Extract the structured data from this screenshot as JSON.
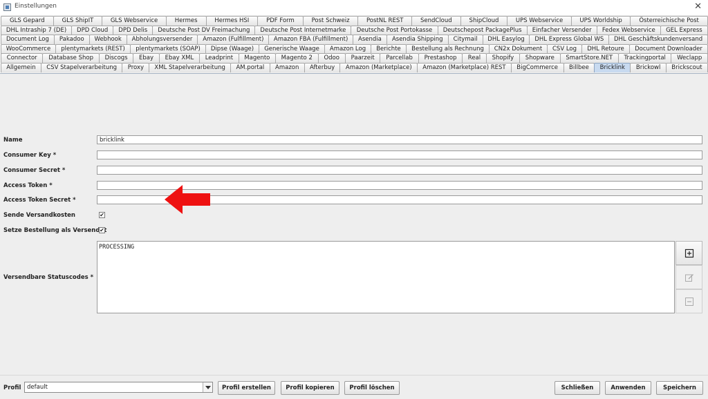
{
  "window": {
    "title": "Einstellungen",
    "close": "✕"
  },
  "tabs": {
    "rows": [
      [
        "GLS Gepard",
        "GLS ShipIT",
        "GLS Webservice",
        "Hermes",
        "Hermes HSI",
        "PDF Form",
        "Post Schweiz",
        "PostNL REST",
        "SendCloud",
        "ShipCloud",
        "UPS Webservice",
        "UPS Worldship",
        "Österreichische Post"
      ],
      [
        "DHL Intraship 7 (DE)",
        "DPD Cloud",
        "DPD Delis",
        "Deutsche Post DV Freimachung",
        "Deutsche Post Internetmarke",
        "Deutsche Post Portokasse",
        "Deutschepost PackagePlus",
        "Einfacher Versender",
        "Fedex Webservice",
        "GEL Express"
      ],
      [
        "Document Log",
        "Pakadoo",
        "Webhook",
        "Abholungsversender",
        "Amazon (Fulfillment)",
        "Amazon FBA (Fulfillment)",
        "Asendia",
        "Asendia Shipping",
        "Citymail",
        "DHL Easylog",
        "DHL Express Global WS",
        "DHL Geschäftskundenversand"
      ],
      [
        "WooCommerce",
        "plentymarkets (REST)",
        "plentymarkets (SOAP)",
        "Dipse (Waage)",
        "Generische Waage",
        "Amazon Log",
        "Berichte",
        "Bestellung als Rechnung",
        "CN2x Dokument",
        "CSV Log",
        "DHL Retoure",
        "Document Downloader"
      ],
      [
        "Connector",
        "Database Shop",
        "Discogs",
        "Ebay",
        "Ebay XML",
        "Leadprint",
        "Magento",
        "Magento 2",
        "Odoo",
        "Paarzeit",
        "Parcellab",
        "Prestashop",
        "Real",
        "Shopify",
        "Shopware",
        "SmartStore.NET",
        "Trackingportal",
        "Weclapp"
      ],
      [
        "Allgemein",
        "CSV Stapelverarbeitung",
        "Proxy",
        "XML Stapelverarbeitung",
        "AM.portal",
        "Amazon",
        "Afterbuy",
        "Amazon (Marketplace)",
        "Amazon (Marketplace) REST",
        "BigCommerce",
        "Billbee",
        "Bricklink",
        "Brickowl",
        "Brickscout"
      ]
    ],
    "active": "Bricklink"
  },
  "form": {
    "name_label": "Name",
    "name_value": "bricklink",
    "consumer_key_label": "Consumer Key *",
    "consumer_key_value": "",
    "consumer_secret_label": "Consumer Secret *",
    "consumer_secret_value": "",
    "access_token_label": "Access Token *",
    "access_token_value": "",
    "access_token_secret_label": "Access Token Secret *",
    "access_token_secret_value": "",
    "send_shipping_label": "Sende Versandkosten",
    "send_shipping_checked": true,
    "set_order_shipped_label": "Setze Bestellung als Versendet",
    "set_order_shipped_checked": true,
    "status_codes_label": "Versendbare Statuscodes *",
    "status_codes": [
      "PROCESSING"
    ],
    "check_mark": "✔"
  },
  "annotation": {
    "arrow_color": "#ee1111"
  },
  "icons": {
    "add": "plus-box-icon",
    "edit": "edit-icon",
    "remove": "minus-box-icon"
  },
  "footer": {
    "profil_label": "Profil",
    "profil_value": "default",
    "create_profile": "Profil erstellen",
    "copy_profile": "Profil kopieren",
    "delete_profile": "Profil löschen",
    "close": "Schließen",
    "apply": "Anwenden",
    "save": "Speichern"
  }
}
